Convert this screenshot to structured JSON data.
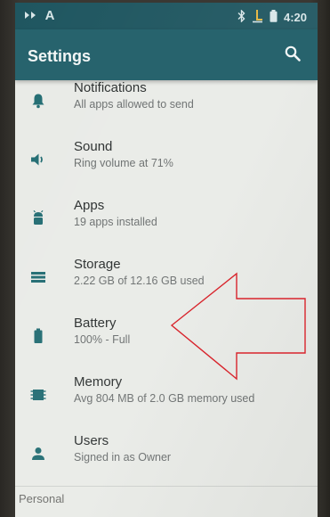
{
  "status_bar": {
    "left_text": "A",
    "time": "4:20",
    "icons": [
      "signal-icon",
      "bluetooth-icon",
      "usb-debug-icon",
      "battery-icon"
    ]
  },
  "app_bar": {
    "title": "Settings",
    "search_icon": "search-icon"
  },
  "colors": {
    "status_bar": "#1f5660",
    "app_bar": "#27636d",
    "icon_accent": "#236d73",
    "background": "#e9ebe7",
    "annotation_arrow": "#d8242c"
  },
  "settings": [
    {
      "icon": "bell-icon",
      "title": "Notifications",
      "summary": "All apps allowed to send"
    },
    {
      "icon": "volume-icon",
      "title": "Sound",
      "summary": "Ring volume at 71%"
    },
    {
      "icon": "android-icon",
      "title": "Apps",
      "summary": "19 apps installed"
    },
    {
      "icon": "storage-icon",
      "title": "Storage",
      "summary": "2.22 GB of 12.16 GB used"
    },
    {
      "icon": "battery-icon",
      "title": "Battery",
      "summary": "100% - Full"
    },
    {
      "icon": "memory-icon",
      "title": "Memory",
      "summary": "Avg 804 MB of 2.0 GB memory used"
    },
    {
      "icon": "user-icon",
      "title": "Users",
      "summary": "Signed in as Owner"
    }
  ],
  "section": {
    "label": "Personal"
  }
}
